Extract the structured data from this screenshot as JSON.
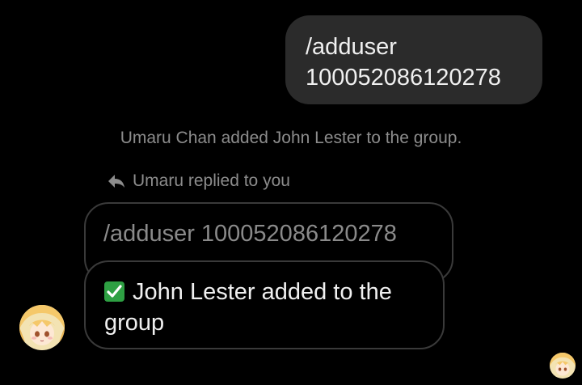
{
  "outgoing_message": {
    "text": "/adduser\n100052086120278"
  },
  "system_notice": {
    "text": "Umaru Chan added John Lester to the group."
  },
  "reply_indicator": {
    "icon": "reply-arrow-icon",
    "text": "Umaru replied to you"
  },
  "quoted_message": {
    "text": "/adduser 100052086120278"
  },
  "incoming_message": {
    "icon": "check-mark-emoji",
    "text": "John Lester added to the group"
  },
  "colors": {
    "background": "#000000",
    "sent_bubble": "#2b2b2b",
    "secondary_text": "#8c8c8c",
    "check_emoji": "#2ea043"
  }
}
